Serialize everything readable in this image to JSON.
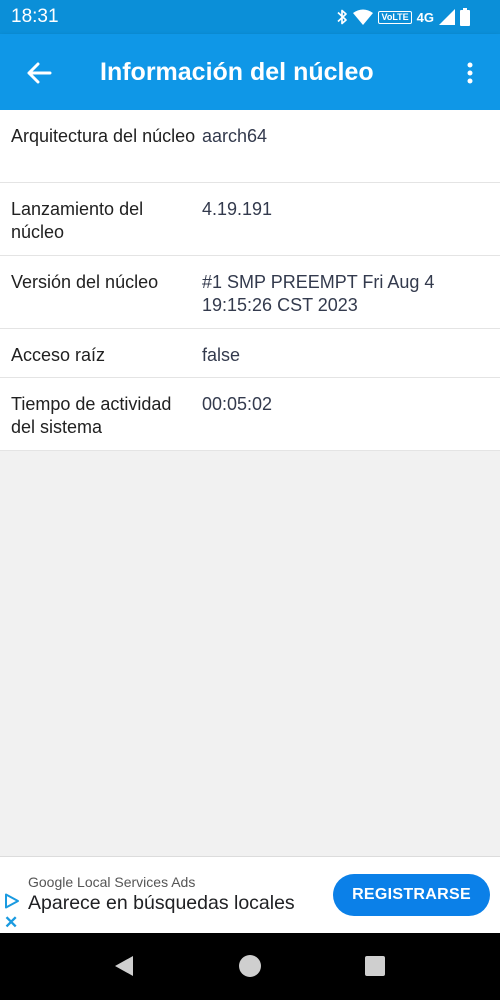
{
  "status_bar": {
    "time": "18:31",
    "volte": "VoLTE",
    "network": "4G",
    "icons": [
      "bluetooth-icon",
      "wifi-icon",
      "signal-icon",
      "battery-icon"
    ]
  },
  "app_bar": {
    "title": "Información del núcleo",
    "back_icon": "arrow-back-icon",
    "menu_icon": "more-vert-icon"
  },
  "info_rows": [
    {
      "label": "Arquitectura del núcleo",
      "value": "aarch64"
    },
    {
      "label": "Lanzamiento del núcleo",
      "value": "4.19.191"
    },
    {
      "label": "Versión del núcleo",
      "value": "#1 SMP PREEMPT Fri Aug 4 19:15:26 CST 2023"
    },
    {
      "label": "Acceso raíz",
      "value": "false"
    },
    {
      "label": "Tiempo de actividad del sistema",
      "value": "00:05:02"
    }
  ],
  "ad": {
    "advertiser": "Google Local Services Ads",
    "headline": "Aparece en búsquedas locales",
    "cta": "REGISTRARSE",
    "adchoices_icon": "play-triangle-icon",
    "close_label": "✕"
  },
  "nav": {
    "icons": [
      "nav-back-icon",
      "nav-home-icon",
      "nav-recents-icon"
    ]
  },
  "colors": {
    "status_bar": "#0b8fd8",
    "app_bar": "#0f97e7",
    "cta": "#0b80e8",
    "background": "#f1f1f1"
  }
}
